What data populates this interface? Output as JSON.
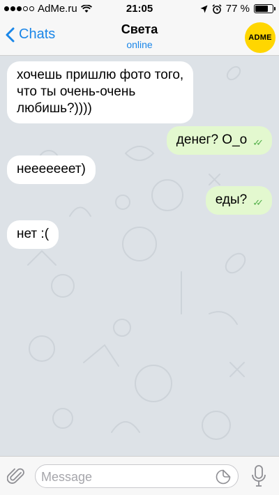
{
  "status_bar": {
    "carrier": "AdMe.ru",
    "time": "21:05",
    "battery": "77 %",
    "battery_level": 0.77,
    "signal_bars_filled": 3,
    "signal_bars_total": 5
  },
  "header": {
    "back_label": "Chats",
    "contact_name": "Света",
    "contact_status": "online",
    "avatar_text": "ADME"
  },
  "messages": [
    {
      "direction": "in",
      "text": "хочешь пришлю фото того,\nчто ты очень-очень\nлюбишь?))))"
    },
    {
      "direction": "out",
      "text": "денег? O_o",
      "read": true
    },
    {
      "direction": "in",
      "text": "нееееееет)"
    },
    {
      "direction": "out",
      "text": "еды?",
      "read": true
    },
    {
      "direction": "in",
      "text": "нет :("
    }
  ],
  "input_bar": {
    "placeholder": "Message"
  },
  "colors": {
    "accent": "#1a86e8",
    "chat_background": "#dde2e7",
    "incoming_bubble": "#ffffff",
    "outgoing_bubble": "#e3f8cf",
    "read_ticks": "#53b04a",
    "avatar_background": "#ffd600"
  }
}
